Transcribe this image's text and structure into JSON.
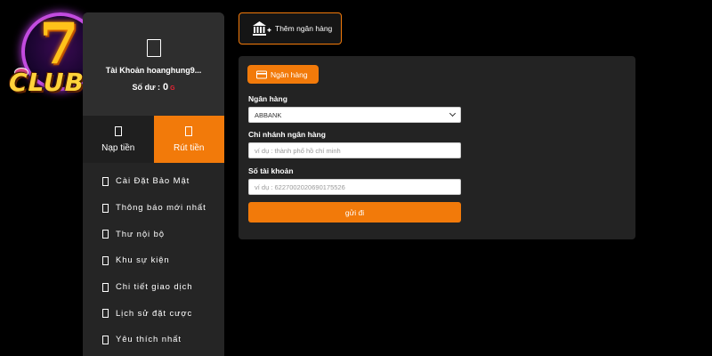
{
  "logo": {
    "text_seven": "7",
    "text_club": "CLUB"
  },
  "profile": {
    "account_label": "Tài Khoản hoanghung9...",
    "balance_label": "Số dư :",
    "balance_value": "0",
    "refresh_symbol": "G"
  },
  "tabs": {
    "deposit": "Nạp tiền",
    "withdraw": "Rút tiền"
  },
  "menu": [
    {
      "label": "Cài Đặt Bảo Mật"
    },
    {
      "label": "Thông báo mới nhất"
    },
    {
      "label": "Thư nội bộ"
    },
    {
      "label": "Khu sự kiện"
    },
    {
      "label": "Chi tiết giao dịch"
    },
    {
      "label": "Lịch sử đặt cược"
    },
    {
      "label": "Yêu thích nhất"
    }
  ],
  "add_bank": {
    "label": "Thêm ngân hàng"
  },
  "form": {
    "section_label": "Ngân hàng",
    "bank_label": "Ngân hàng",
    "bank_selected": "ABBANK",
    "branch_label": "Chi nhánh ngân hàng",
    "branch_placeholder": "ví dụ : thành phố hồ chí minh",
    "account_label": "Số tài khoản",
    "account_placeholder": "ví dụ : 6227002020690175526",
    "submit_label": "gửi đi"
  },
  "colors": {
    "accent": "#f27a0a",
    "panel": "#252525",
    "card": "#232323",
    "background": "#000000"
  }
}
